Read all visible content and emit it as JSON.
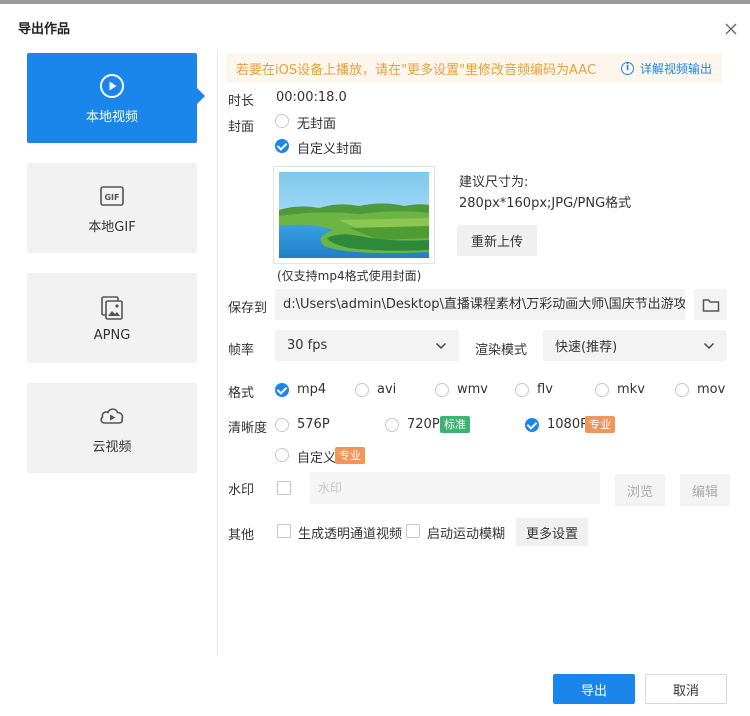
{
  "dialog": {
    "title": "导出作品"
  },
  "sidebar": {
    "items": [
      {
        "label": "本地视频",
        "icon": "play-circle-icon",
        "active": true
      },
      {
        "label": "本地GIF",
        "icon": "gif-icon",
        "active": false
      },
      {
        "label": "APNG",
        "icon": "image-stack-icon",
        "active": false
      },
      {
        "label": "云视频",
        "icon": "cloud-play-icon",
        "active": false
      }
    ],
    "accent": "#1a86ec"
  },
  "notice": {
    "warning": "若要在iOS设备上播放，请在\"更多设置\"里修改音频编码为AAC",
    "help_icon_text": "i",
    "help_link": "详解视频输出"
  },
  "duration": {
    "label": "时长",
    "value": "00:00:18.0"
  },
  "cover": {
    "label": "封面",
    "options": [
      {
        "label": "无封面",
        "selected": false
      },
      {
        "label": "自定义封面",
        "selected": true
      }
    ],
    "suggest_title": "建议尺寸为:",
    "suggest_detail": "280px*160px;JPG/PNG格式",
    "reupload": "重新上传",
    "note": "(仅支持mp4格式使用封面)"
  },
  "save": {
    "label": "保存到",
    "path": "d:\\Users\\admin\\Desktop\\直播课程素材\\万彩动画大师\\国庆节出游攻"
  },
  "framerate": {
    "label": "帧率",
    "value": "30 fps"
  },
  "render": {
    "label": "渲染模式",
    "value": "快速(推荐)"
  },
  "format": {
    "label": "格式",
    "options": [
      {
        "label": "mp4",
        "selected": true
      },
      {
        "label": "avi",
        "selected": false
      },
      {
        "label": "wmv",
        "selected": false
      },
      {
        "label": "flv",
        "selected": false
      },
      {
        "label": "mkv",
        "selected": false
      },
      {
        "label": "mov",
        "selected": false
      }
    ]
  },
  "resolution": {
    "label": "清晰度",
    "options": [
      {
        "label": "576P",
        "selected": false,
        "tag": ""
      },
      {
        "label": "720P",
        "selected": false,
        "tag": "标准"
      },
      {
        "label": "1080P",
        "selected": true,
        "tag": "专业"
      },
      {
        "label": "自定义",
        "selected": false,
        "tag": "专业"
      }
    ]
  },
  "watermark": {
    "label": "水印",
    "placeholder": "水印",
    "browse": "浏览",
    "edit": "编辑",
    "checked": false
  },
  "other": {
    "label": "其他",
    "transparent": "生成透明通道视频",
    "motion_blur": "启动运动模糊",
    "more": "更多设置"
  },
  "footer": {
    "export": "导出",
    "cancel": "取消"
  }
}
